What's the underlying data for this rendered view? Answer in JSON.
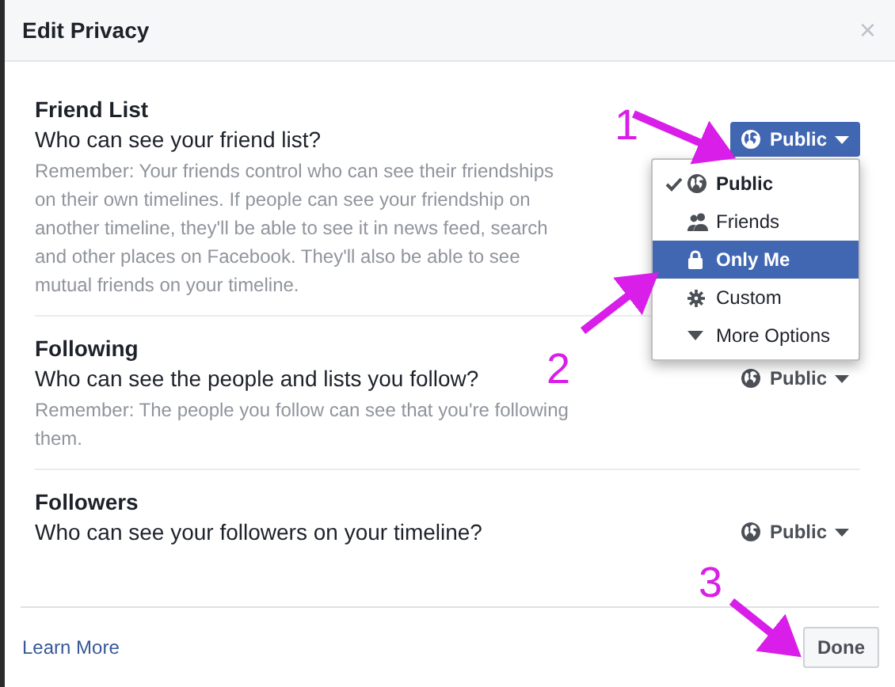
{
  "dialog": {
    "title": "Edit Privacy",
    "close": "×"
  },
  "sections": [
    {
      "title": "Friend List",
      "question": "Who can see your friend list?",
      "note": "Remember: Your friends control who can see their friendships on their own timelines. If people can see your friendship on another timeline, they'll be able to see it in news feed, search and other places on Facebook. They'll also be able to see mutual friends on your timeline.",
      "selector": {
        "value": "Public",
        "open": true,
        "menu": [
          {
            "label": "Public",
            "kind": "public",
            "checked": true,
            "highlighted": false
          },
          {
            "label": "Friends",
            "kind": "friends",
            "checked": false,
            "highlighted": false
          },
          {
            "label": "Only Me",
            "kind": "private",
            "checked": false,
            "highlighted": true
          },
          {
            "label": "Custom",
            "kind": "custom",
            "checked": false,
            "highlighted": false
          },
          {
            "label": "More Options",
            "kind": "more",
            "checked": false,
            "highlighted": false
          }
        ]
      }
    },
    {
      "title": "Following",
      "question": "Who can see the people and lists you follow?",
      "note": "Remember: The people you follow can see that you're following them.",
      "selector": {
        "value": "Public",
        "open": false
      }
    },
    {
      "title": "Followers",
      "question": "Who can see your followers on your timeline?",
      "selector": {
        "value": "Public",
        "open": false
      }
    }
  ],
  "footer": {
    "link": "Learn More",
    "button": "Done"
  },
  "annotations": [
    {
      "label": "1"
    },
    {
      "label": "2"
    },
    {
      "label": "3"
    }
  ]
}
